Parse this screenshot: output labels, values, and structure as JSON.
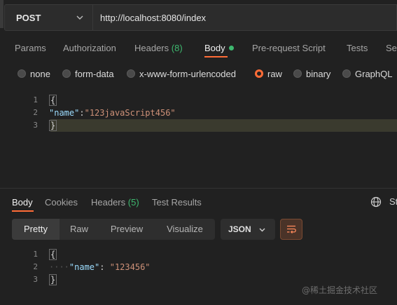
{
  "request": {
    "method": "POST",
    "url": "http://localhost:8080/index"
  },
  "request_tabs": {
    "params": "Params",
    "authorization": "Authorization",
    "headers": "Headers",
    "headers_count": "(8)",
    "body": "Body",
    "pre_request": "Pre-request Script",
    "tests": "Tests",
    "settings": "Se"
  },
  "body_types": {
    "none": "none",
    "form_data": "form-data",
    "urlencoded": "x-www-form-urlencoded",
    "raw": "raw",
    "binary": "binary",
    "graphql": "GraphQL",
    "selected": "raw"
  },
  "request_body": {
    "line_numbers": [
      "1",
      "2",
      "3"
    ],
    "open_brace": "{",
    "key": "\"name\"",
    "colon": ":",
    "value": "\"123javaScript456\"",
    "close_brace": "}"
  },
  "response_tabs": {
    "body": "Body",
    "cookies": "Cookies",
    "headers": "Headers",
    "headers_count": "(5)",
    "test_results": "Test Results",
    "status_cut": "St"
  },
  "response_toolbar": {
    "pretty": "Pretty",
    "raw": "Raw",
    "preview": "Preview",
    "visualize": "Visualize",
    "format": "JSON"
  },
  "response_body": {
    "line_numbers": [
      "1",
      "2",
      "3"
    ],
    "open_brace": "{",
    "indent": "····",
    "key": "\"name\"",
    "colon": ": ",
    "value": "\"123456\"",
    "close_brace": "}"
  },
  "watermark": "@稀土掘金技术社区",
  "colors": {
    "accent": "#ff6c37",
    "count_green": "#3eb86f",
    "json_key": "#9cdcfe",
    "json_string": "#ce9178"
  }
}
